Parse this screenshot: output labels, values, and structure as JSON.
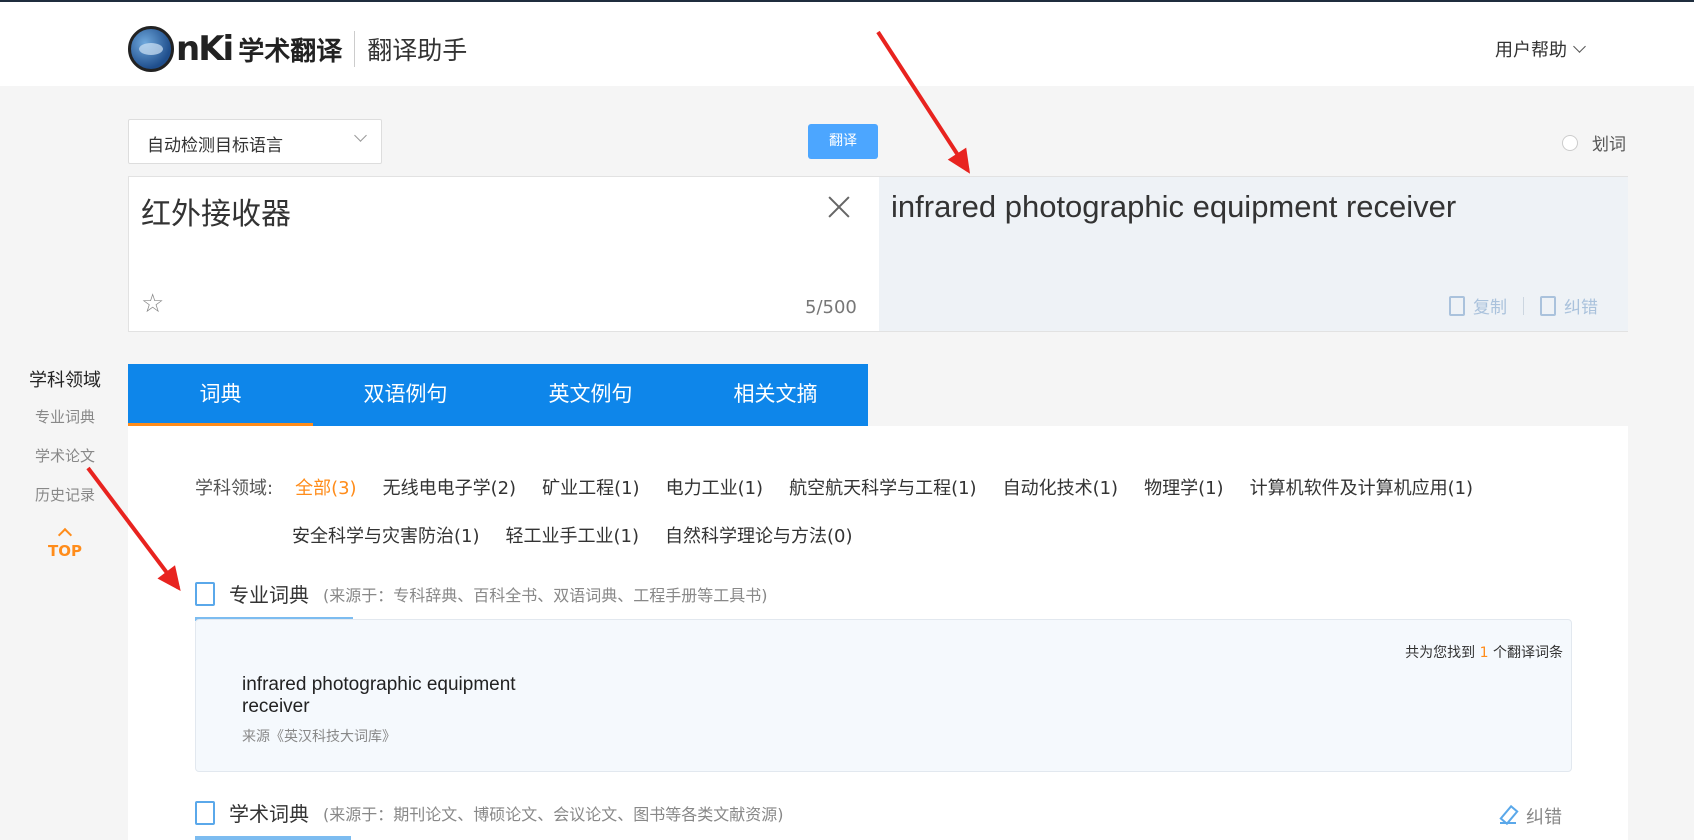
{
  "header": {
    "logo_text": "nKi",
    "logo_sub": "学术翻译",
    "helper": "翻译助手",
    "help_menu": "用户帮助"
  },
  "controls": {
    "lang_select": "自动检测目标语言",
    "translate_button": "翻译",
    "hua_label": "划词"
  },
  "input": {
    "text": "红外接收器",
    "count": "5/500"
  },
  "output": {
    "text": "infrared photographic equipment receiver",
    "copy_label": "复制",
    "error_label": "纠错"
  },
  "sidebar": {
    "title": "学科领域",
    "items": [
      "专业词典",
      "学术论文",
      "历史记录"
    ],
    "top": "TOP"
  },
  "tabs": [
    "词典",
    "双语例句",
    "英文例句",
    "相关文摘"
  ],
  "filters": {
    "label": "学科领域:",
    "row1": [
      "全部(3)",
      "无线电电子学(2)",
      "矿业工程(1)",
      "电力工业(1)",
      "航空航天科学与工程(1)",
      "自动化技术(1)",
      "物理学(1)",
      "计算机软件及计算机应用(1)"
    ],
    "row2": [
      "安全科学与灾害防治(1)",
      "轻工业手工业(1)",
      "自然科学理论与方法(0)"
    ]
  },
  "section1": {
    "title": "专业词典",
    "note": "(来源于：专科辞典、百科全书、双语词典、工程手册等工具书)",
    "found_prefix": "共为您找到",
    "found_num": "1",
    "found_suffix": "个翻译词条",
    "entry": "infrared photographic equipment receiver",
    "entry_src": "来源《英汉科技大词库》"
  },
  "section2": {
    "title": "学术词典",
    "note": "(来源于：期刊论文、博硕论文、会议论文、图书等各类文献资源)",
    "error_label": "纠错"
  },
  "colors": {
    "accent": "#0e86ea",
    "highlight": "#ff8c1a",
    "arrow": "#e8231f"
  }
}
